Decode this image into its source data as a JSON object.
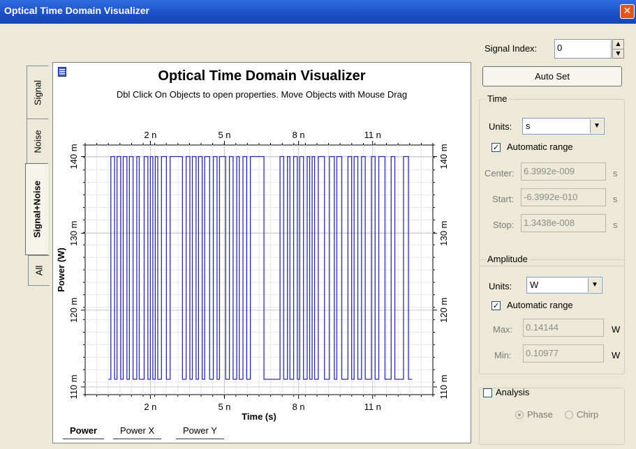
{
  "window": {
    "title": "Optical Time Domain Visualizer",
    "close_glyph": "✕"
  },
  "side_tabs": [
    "Signal",
    "Noise",
    "Signal+Noise",
    "All"
  ],
  "plot": {
    "title": "Optical Time Domain Visualizer",
    "subtitle": "Dbl Click On Objects to open properties.  Move Objects with Mouse Drag"
  },
  "bottom_tabs": [
    "Power",
    "Power X",
    "Power Y"
  ],
  "chart_data": {
    "type": "line",
    "title": "Optical Time Domain Visualizer",
    "xlabel": "Time (s)",
    "ylabel": "Power (W)",
    "x_ticks": [
      "2 n",
      "5 n",
      "8 n",
      "11 n"
    ],
    "x_tick_values": [
      2e-09,
      5e-09,
      8e-09,
      1.1e-08
    ],
    "y_ticks": [
      "110 m",
      "120 m",
      "130 m",
      "140 m"
    ],
    "y_tick_values": [
      0.11,
      0.12,
      0.13,
      0.14
    ],
    "xlim": [
      -6.3992e-10,
      1.3438e-08
    ],
    "ylim": [
      0.109,
      0.1415
    ],
    "grid": true,
    "color": "#2c2caa",
    "levels": {
      "high": 0.14,
      "low": 0.111
    },
    "series": [
      {
        "transitions_ns": [
          0.3,
          0.4,
          0.55,
          0.65,
          0.8,
          0.9,
          1.05,
          1.15,
          1.3,
          1.45,
          1.55,
          1.75,
          1.9,
          2.0,
          2.1,
          2.2,
          2.3,
          2.45,
          2.65,
          2.8,
          3.3,
          3.45,
          3.6,
          3.7,
          3.85,
          3.95,
          4.1,
          4.2,
          4.4,
          4.55,
          4.7,
          4.8,
          5.05,
          5.2,
          5.35,
          5.5,
          5.6,
          5.75,
          5.9,
          6.05,
          6.6,
          7.25,
          7.4,
          7.55,
          7.65,
          7.8,
          7.95,
          8.05,
          8.2,
          8.35,
          8.45,
          8.55,
          8.65,
          8.8,
          9.05,
          9.25,
          9.45,
          9.55,
          9.75,
          10.0,
          10.15,
          10.25,
          10.4,
          10.55,
          10.7,
          10.95,
          11.1,
          11.25,
          11.5,
          11.75,
          11.9,
          12.25,
          12.45
        ],
        "first_level": "low",
        "x_end_ns": 12.6
      }
    ]
  },
  "controls": {
    "signal_index_label": "Signal Index:",
    "signal_index_value": "0",
    "auto_set": "Auto Set",
    "time": {
      "title": "Time",
      "units_label": "Units:",
      "units_value": "s",
      "automatic_range": "Automatic range",
      "center_label": "Center:",
      "center_value": "6.3992e-009",
      "center_unit": "s",
      "start_label": "Start:",
      "start_value": "-6.3992e-010",
      "start_unit": "s",
      "stop_label": "Stop:",
      "stop_value": "1.3438e-008",
      "stop_unit": "s"
    },
    "amplitude": {
      "title": "Amplitude",
      "units_label": "Units:",
      "units_value": "W",
      "automatic_range": "Automatic range",
      "max_label": "Max:",
      "max_value": "0.14144",
      "max_unit": "W",
      "min_label": "Min:",
      "min_value": "0.10977",
      "min_unit": "W"
    },
    "analysis": {
      "title": "Analysis",
      "phase": "Phase",
      "chirp": "Chirp"
    }
  }
}
